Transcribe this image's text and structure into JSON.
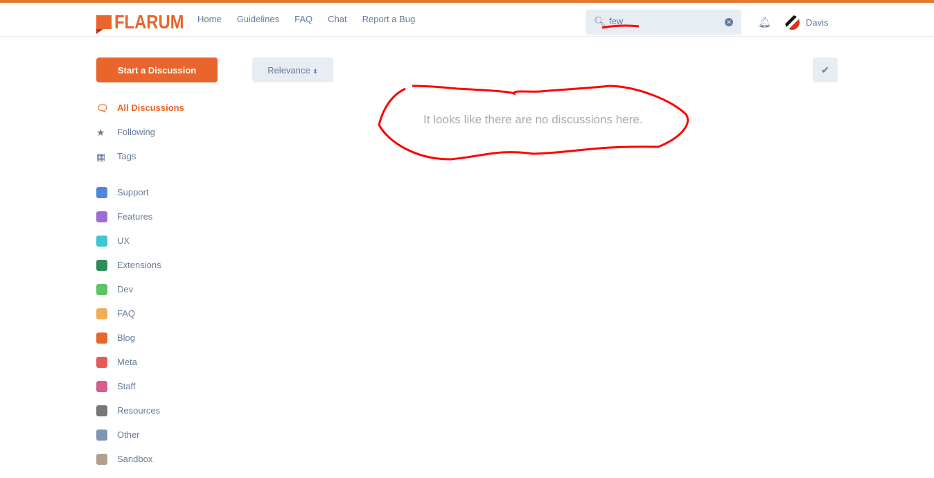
{
  "header": {
    "logo": "FLARUM",
    "nav": [
      "Home",
      "Guidelines",
      "FAQ",
      "Chat",
      "Report a Bug"
    ],
    "search": {
      "value": "few",
      "placeholder": "Search Forum"
    },
    "user": "Davis"
  },
  "toolbar": {
    "start": "Start a Discussion",
    "sort": "Relevance",
    "mark_read_icon": "check-icon"
  },
  "sidebar": {
    "main": [
      {
        "label": "All Discussions",
        "icon": "comments-icon"
      },
      {
        "label": "Following",
        "icon": "star-icon"
      },
      {
        "label": "Tags",
        "icon": "grid-icon"
      }
    ],
    "tags": [
      {
        "label": "Support",
        "color": "#4d88dc"
      },
      {
        "label": "Features",
        "color": "#9b6dd6"
      },
      {
        "label": "UX",
        "color": "#3fc6cf"
      },
      {
        "label": "Extensions",
        "color": "#2e8b5c"
      },
      {
        "label": "Dev",
        "color": "#5cc465"
      },
      {
        "label": "FAQ",
        "color": "#edae55"
      },
      {
        "label": "Blog",
        "color": "#e8652b"
      },
      {
        "label": "Meta",
        "color": "#e55b5b"
      },
      {
        "label": "Staff",
        "color": "#d95c8f"
      },
      {
        "label": "Resources",
        "color": "#777777"
      },
      {
        "label": "Other",
        "color": "#7f94b5"
      },
      {
        "label": "Sandbox",
        "color": "#b0a08f"
      }
    ]
  },
  "main": {
    "empty": "It looks like there are no discussions here."
  },
  "colors": {
    "accent": "#e8652b",
    "annotation": "#ff0000"
  }
}
